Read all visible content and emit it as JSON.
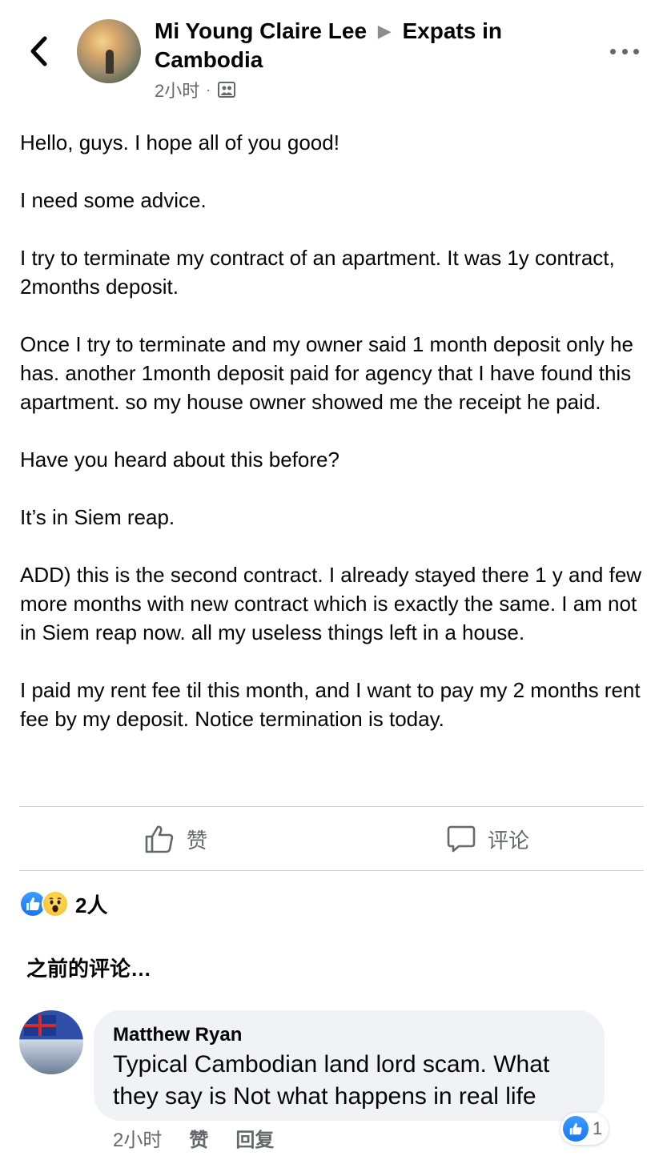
{
  "header": {
    "back_icon": "chevron-left-icon",
    "author": "Mi Young Claire Lee",
    "separator_icon": "triangle-right-icon",
    "group": "Expats in Cambodia",
    "time": "2小时",
    "dot": "·",
    "audience_icon": "group-icon",
    "more_icon": "more-dots-icon"
  },
  "post": {
    "paragraphs": [
      "Hello, guys. I hope all of you good!",
      "I need some advice.",
      "I try to terminate my contract of an apartment. It was 1y contract, 2months deposit.",
      "Once I try to terminate and my owner said 1 month deposit only he has. another 1month deposit paid for agency that I have found this apartment. so my house owner showed me the receipt he paid.",
      "Have you heard about this before?",
      "It’s in Siem reap.",
      "ADD) this is the second contract. I already stayed there 1 y and few more months with new contract which is exactly the same. I am not in Siem reap now. all my useless things left in a house.",
      "I paid my rent fee til this month, and I want to pay my 2 months rent fee by my deposit. Notice termination is today."
    ]
  },
  "actions": {
    "like_label": "赞",
    "comment_label": "评论"
  },
  "reactions": {
    "types": [
      "like-reaction-icon",
      "wow-reaction-icon"
    ],
    "count": "2人"
  },
  "previous_comments_label": "之前的评论…",
  "comment": {
    "author": "Matthew Ryan",
    "text": "Typical Cambodian land lord scam. What they say is Not what happens in real life",
    "time": "2小时",
    "like_label": "赞",
    "reply_label": "回复",
    "like_count": "1"
  },
  "colors": {
    "text_primary": "#050505",
    "text_secondary": "#65676b",
    "accent_blue": "#1877f2",
    "bubble_bg": "#f0f2f5",
    "divider": "#ced0d4"
  }
}
